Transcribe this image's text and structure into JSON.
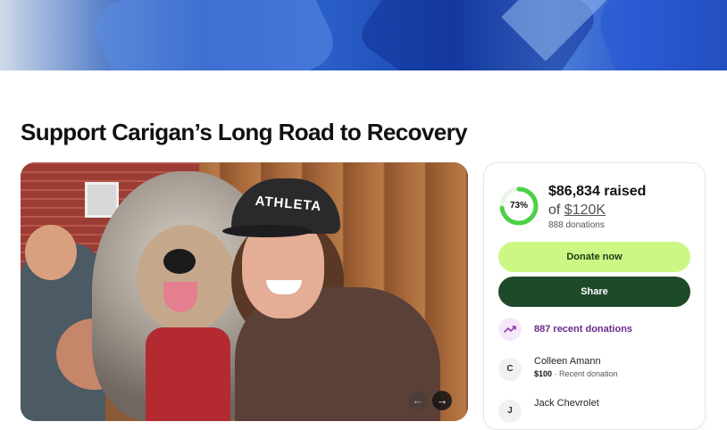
{
  "campaign": {
    "title": "Support Carigan’s Long Road to Recovery",
    "photo_cap_text": "ATHLETA"
  },
  "progress": {
    "percent": 73,
    "percent_label": "73%",
    "raised": "$86,834 raised",
    "goal_prefix": "of",
    "goal_amount": "$120K",
    "donation_count": "888 donations"
  },
  "actions": {
    "donate_label": "Donate now",
    "share_label": "Share"
  },
  "recent": {
    "label": "887 recent donations"
  },
  "donors": [
    {
      "initial": "C",
      "name": "Colleen Amann",
      "amount": "$100",
      "meta": " · Recent donation"
    },
    {
      "initial": "J",
      "name": "Jack Chevrolet",
      "amount": "",
      "meta": ""
    }
  ],
  "colors": {
    "accent_green": "#cdf784",
    "dark_green": "#1f4a2a",
    "ring_green": "#4cd148",
    "purple_text": "#6b2a8c"
  },
  "icons": {
    "prev": "arrow-left-icon",
    "next": "arrow-right-icon",
    "trend": "trending-up-icon"
  }
}
